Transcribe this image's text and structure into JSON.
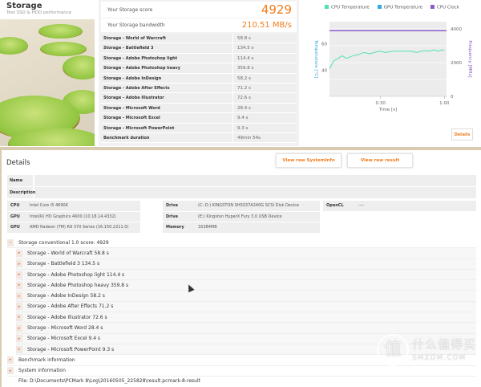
{
  "header": {
    "title": "Storage",
    "subtitle": "Test SSD & HDD performance"
  },
  "score": {
    "label": "Your Storage score",
    "value": "4929"
  },
  "bandwidth": {
    "label": "Your Storage bandwidth",
    "value": "210.51 MB/s"
  },
  "results": [
    {
      "name": "Storage - World of Warcraft",
      "value": "58.8 s"
    },
    {
      "name": "Storage - Battlefield 3",
      "value": "134.5 s"
    },
    {
      "name": "Storage - Adobe Photoshop light",
      "value": "114.4 s"
    },
    {
      "name": "Storage - Adobe Photoshop heavy",
      "value": "359.8 s"
    },
    {
      "name": "Storage - Adobe InDesign",
      "value": "58.2 s"
    },
    {
      "name": "Storage - Adobe After Effects",
      "value": "71.2 s"
    },
    {
      "name": "Storage - Adobe Illustrator",
      "value": "72.6 s"
    },
    {
      "name": "Storage - Microsoft Word",
      "value": "28.4 s"
    },
    {
      "name": "Storage - Microsoft Excel",
      "value": "9.4 s"
    },
    {
      "name": "Storage - Microsoft PowerPoint",
      "value": "9.3 s"
    },
    {
      "name": "Benchmark duration",
      "value": "49min 54s"
    }
  ],
  "chart_data": {
    "type": "line",
    "xlabel": "Time [s]",
    "ylabel": "Temperature [°C]",
    "y2label": "Frequency [MHz]",
    "xlim": [
      6,
      61
    ],
    "ylim": [
      20,
      77
    ],
    "y2lim": [
      0,
      4430
    ],
    "xticks": [
      {
        "v": 30,
        "label": "0:30"
      },
      {
        "v": 60,
        "label": "1:00"
      }
    ],
    "yticks": [
      {
        "v": 40,
        "label": "40"
      },
      {
        "v": 60,
        "label": "60"
      }
    ],
    "y2ticks": [
      {
        "v": 0,
        "label": "0"
      },
      {
        "v": 2000,
        "label": "2000"
      },
      {
        "v": 4000,
        "label": "4000"
      }
    ],
    "grid": true,
    "legend_position": "top",
    "series": [
      {
        "name": "CPU Temperature",
        "color": "#4fe3b0",
        "axis": "left",
        "x": [
          6,
          8,
          12,
          14,
          17,
          20,
          22,
          25,
          27,
          28,
          30,
          32,
          36,
          44,
          47,
          51,
          53,
          55,
          57,
          59,
          60
        ],
        "y": [
          41,
          47,
          51,
          49,
          51,
          52,
          53.5,
          52.5,
          53.5,
          54,
          54.5,
          53.5,
          54.5,
          54.5,
          53.5,
          55,
          54.5,
          55.5,
          54.5,
          55.5,
          55
        ]
      },
      {
        "name": "GPU Temperature",
        "color": "#3aa8e0",
        "axis": "left",
        "x": [],
        "y": []
      },
      {
        "name": "CPU Clock",
        "color": "#8a5cc8",
        "axis": "right",
        "x": [
          6,
          61
        ],
        "y": [
          3900,
          3900
        ]
      }
    ]
  },
  "chart_details_label": "Details",
  "details": {
    "title": "Details",
    "view_sysinfo": "View raw SystemInfo",
    "view_result": "View raw result",
    "name_label": "Name",
    "description_label": "Description",
    "specs_col1": [
      {
        "k": "CPU",
        "v": "Intel Core i5 4690K"
      },
      {
        "k": "GPU",
        "v": "Intel(R) HD Graphics 4600 (10.18.14.4332)"
      },
      {
        "k": "GPU",
        "v": "AMD Radeon (TM) R9 370 Series (16.150.2211.0)"
      }
    ],
    "specs_col2": [
      {
        "k": "Drive",
        "v": "(C: D:) KINGSTON SHSS37A240G SCSI Disk Device"
      },
      {
        "k": "Drive",
        "v": "(E:) Kingston HyperX Fury 3.0 USB Device"
      },
      {
        "k": "Memory",
        "v": "16384MB"
      }
    ],
    "specs_col3": [
      {
        "k": "OpenCL",
        "v": "----"
      }
    ],
    "tree_root": "Storage conventional 1.0 score: 4929",
    "tree_items": [
      "Storage - World of Warcraft 58.8 s",
      "Storage - Battlefield 3 134.5 s",
      "Storage - Adobe Photoshop light 114.4 s",
      "Storage - Adobe Photoshop heavy 359.8 s",
      "Storage - Adobe InDesign 58.2 s",
      "Storage - Adobe After Effects 71.2 s",
      "Storage - Adobe Illustrator 72.6 s",
      "Storage - Microsoft Word 28.4 s",
      "Storage - Microsoft Excel 9.4 s",
      "Storage - Microsoft PowerPoint 9.3 s"
    ],
    "benchmark_info": "Benchmark information",
    "system_info": "System information",
    "file": "File: D:\\Documents\\PCMark 8\\Log\\20160505_225828\\result.pcmark-8-result"
  },
  "watermark": {
    "glyph": "值",
    "text": "什么值得买",
    "domain": "SMZDM.COM"
  }
}
